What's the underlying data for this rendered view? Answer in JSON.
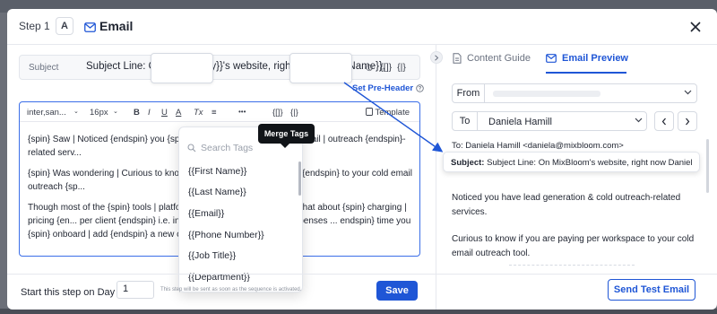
{
  "header": {
    "step_label": "Step 1",
    "step_badge": "A",
    "title": "Email",
    "close_icon": "close-icon"
  },
  "subject": {
    "label": "Subject",
    "value": "Subject Line: On {{Company}}'s website, right now {{First Name}},",
    "icons": [
      "emoji-icon",
      "merge-tag-icon",
      "spintax-icon"
    ],
    "emoji_glyph": "☺",
    "merge_glyph": "{[]}",
    "spin_glyph": "{|}",
    "preheader_label": "Set Pre-Header"
  },
  "toolbar": {
    "font_family": "inter,san...",
    "font_size": "16px",
    "bold": "B",
    "italic": "I",
    "underline": "U",
    "text_color": "A",
    "clear_format": "Tx",
    "align": "≡",
    "more": "•••",
    "merge_tags": "{[]}",
    "spintax": "{|}",
    "template_label": "Template"
  },
  "editor": {
    "paragraphs": [
      "{spin} Saw | Noticed {endspin} you {spin} ... generation & cold {spin} email | outreach {endspin}-related serv...",
      "{spin} Was wondering | Curious to know ... r {spin} workspace | client {endspin} to your cold email outreach {sp...",
      "Though most of the {spin} tools | platfo... limited email accounts but what about {spin} charging | pricing {en... per client {endspin} i.e. increasing your {spin} costs | expenses ... endspin} time you {spin} onboard | add {endspin} a new client."
    ]
  },
  "tooltip": "Merge Tags",
  "merge_dropdown": {
    "search_placeholder": "Search Tags",
    "items": [
      "{{First Name}}",
      "{{Last Name}}",
      "{{Email}}",
      "{{Phone Number}}",
      "{{Job Title}}",
      "{{Department}}"
    ]
  },
  "footer": {
    "start_label": "Start this step on Day",
    "day_value": "1",
    "note": "This step will be sent as soon as the sequence is activated.",
    "save_label": "Save",
    "test_label": "Send Test Email"
  },
  "right_panel": {
    "tabs": [
      {
        "label": "Content Guide",
        "icon": "document-icon",
        "active": false
      },
      {
        "label": "Email Preview",
        "icon": "mail-icon",
        "active": true
      }
    ],
    "from_label": "From",
    "to_label": "To",
    "to_value": "Daniela Hamill",
    "to_line": "To: Daniela Hamill <daniela@mixbloom.com>",
    "subject_prefix": "Subject:",
    "subject_preview": "Subject Line: On MixBloom's website, right now Daniel",
    "preview_paragraphs": [
      "Noticed you have lead generation & cold outreach-related services.",
      "Curious to know if you are paying per workspace to your cold email outreach tool."
    ]
  },
  "colors": {
    "accent": "#1f56d6",
    "text": "#1f2430",
    "border": "#d6dae2"
  }
}
